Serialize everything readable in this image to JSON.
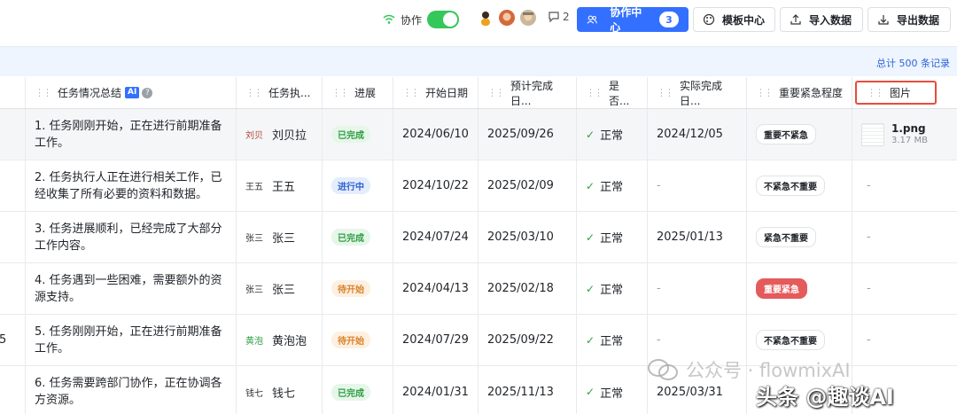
{
  "toolbar": {
    "collab_label": "协作",
    "comment_count": "2",
    "collab_center_label": "协作中心",
    "collab_center_count": "3",
    "template_label": "模板中心",
    "import_label": "导入数据",
    "export_label": "导出数据"
  },
  "infobar": {
    "total_text": "总计 500 条记录"
  },
  "columns": {
    "summary": "任务情况总结",
    "ai_badge": "AI",
    "help": "?",
    "assignee": "任务执...",
    "progress": "进展",
    "start": "开始日期",
    "planned": "预计完成日...",
    "normal": "是否...",
    "actual": "实际完成日...",
    "priority": "重要紧急程度",
    "image": "图片"
  },
  "rows": [
    {
      "summary": "1. 任务刚刚开始，正在进行前期准备工作。",
      "chip": "刘贝",
      "name": "刘贝拉",
      "status": "已完成",
      "status_type": "done",
      "start": "2024/06/10",
      "planned": "2025/09/26",
      "normal": "正常",
      "actual": "2024/12/05",
      "priority": "重要不紧急",
      "priority_type": "plain",
      "file_name": "1.png",
      "file_size": "3.17 MB"
    },
    {
      "summary": "2. 任务执行人正在进行相关工作，已经收集了所有必要的资料和数据。",
      "chip": "王五",
      "name": "王五",
      "status": "进行中",
      "status_type": "doing",
      "start": "2024/10/22",
      "planned": "2025/02/09",
      "normal": "正常",
      "actual": "-",
      "priority": "不紧急不重要",
      "priority_type": "plain",
      "image": "-"
    },
    {
      "summary": "3. 任务进展顺利，已经完成了大部分工作内容。",
      "chip": "张三",
      "name": "张三",
      "status": "已完成",
      "status_type": "done",
      "start": "2024/07/24",
      "planned": "2025/03/10",
      "normal": "正常",
      "actual": "2025/01/13",
      "priority": "紧急不重要",
      "priority_type": "plain",
      "image": "-"
    },
    {
      "summary": "4. 任务遇到一些困难，需要额外的资源支持。",
      "chip": "张三",
      "name": "张三",
      "status": "待开始",
      "status_type": "todo",
      "start": "2024/04/13",
      "planned": "2025/02/18",
      "normal": "正常",
      "actual": "-",
      "priority": "重要紧急",
      "priority_type": "red",
      "image": "-"
    },
    {
      "summary": "5. 任务刚刚开始，正在进行前期准备工作。",
      "chip": "黄泡",
      "name": "黄泡泡",
      "status": "待开始",
      "status_type": "todo",
      "start": "2024/07/29",
      "planned": "2025/09/22",
      "normal": "正常",
      "actual": "-",
      "priority": "不紧急不重要",
      "priority_type": "plain",
      "image": "-",
      "edge": "5"
    },
    {
      "summary": "6. 任务需要跨部门协作，正在协调各方资源。",
      "chip": "钱七",
      "name": "钱七",
      "status": "已完成",
      "status_type": "done",
      "start": "2024/01/31",
      "planned": "2025/11/13",
      "normal": "正常",
      "actual": "2025/03/31",
      "priority": "",
      "priority_type": "plain",
      "image": "-"
    }
  ],
  "watermark": {
    "wechat": "公众号 · flowmixAI",
    "toutiao": "头条 @趣谈AI"
  },
  "colors": {
    "primary": "#3370ff",
    "toggle": "#34c759",
    "done": "#2f9e44",
    "doing": "#2d5fd3",
    "todo": "#d9822b",
    "urgent": "#e45b5b",
    "highlight": "#e74c3c"
  },
  "icons": [
    "wifi-icon",
    "user-group-icon",
    "palette-icon",
    "upload-icon",
    "download-icon",
    "comment-icon",
    "drag-handle-icon",
    "check-icon"
  ]
}
